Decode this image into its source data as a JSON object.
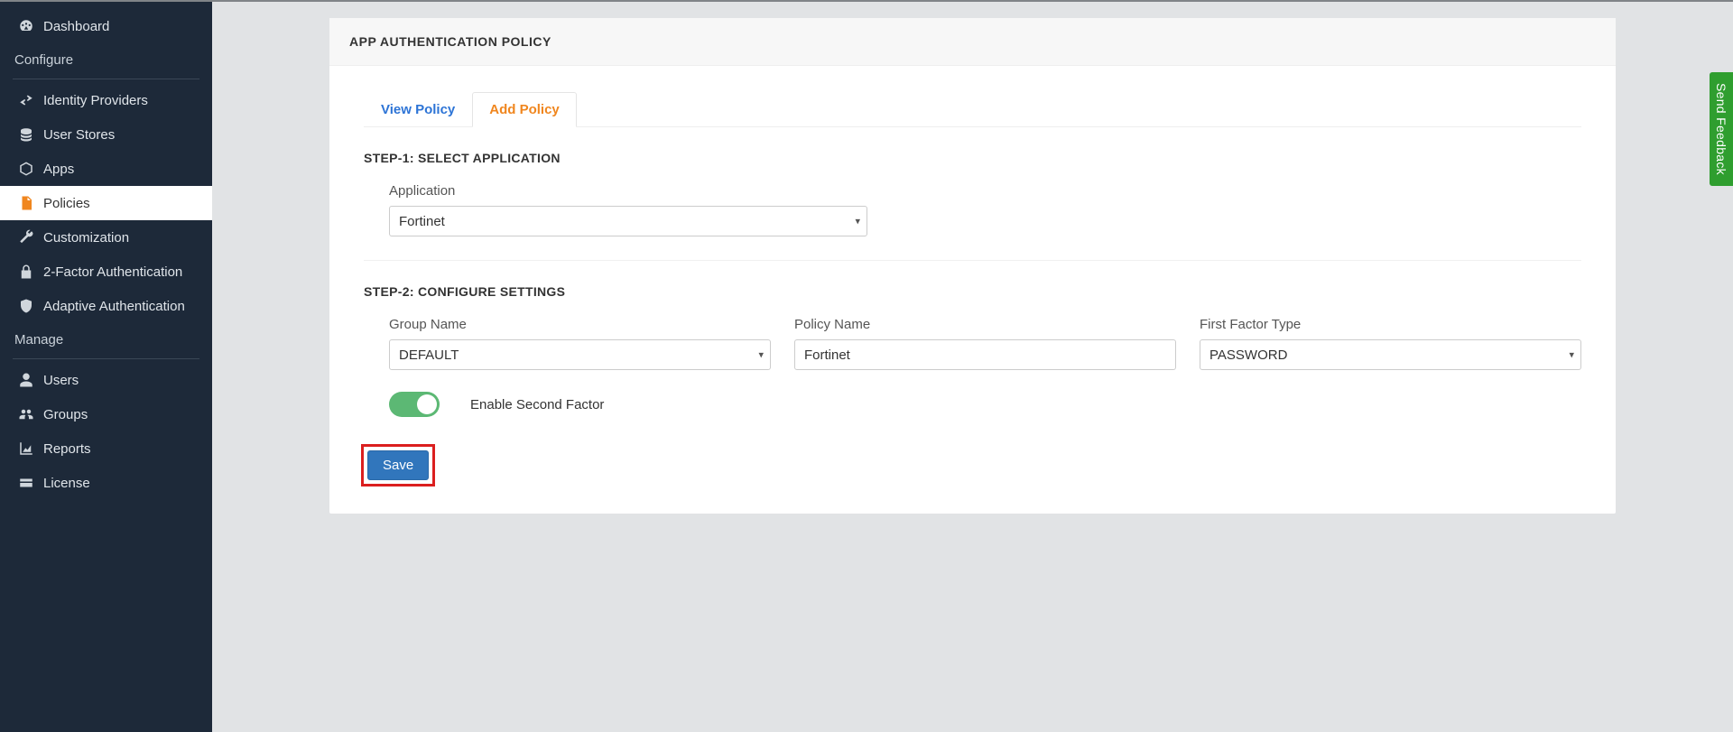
{
  "sidebar": {
    "dashboard": "Dashboard",
    "section_configure": "Configure",
    "identity_providers": "Identity Providers",
    "user_stores": "User Stores",
    "apps": "Apps",
    "policies": "Policies",
    "customization": "Customization",
    "two_factor": "2-Factor Authentication",
    "adaptive_auth": "Adaptive Authentication",
    "section_manage": "Manage",
    "users": "Users",
    "groups": "Groups",
    "reports": "Reports",
    "license": "License"
  },
  "card": {
    "title": "APP AUTHENTICATION POLICY"
  },
  "tabs": {
    "view": "View Policy",
    "add": "Add Policy"
  },
  "step1": {
    "title": "STEP-1: SELECT APPLICATION",
    "application_label": "Application",
    "application_value": "Fortinet"
  },
  "step2": {
    "title": "STEP-2: CONFIGURE SETTINGS",
    "group_name_label": "Group Name",
    "group_name_value": "DEFAULT",
    "policy_name_label": "Policy Name",
    "policy_name_value": "Fortinet",
    "first_factor_label": "First Factor Type",
    "first_factor_value": "PASSWORD",
    "enable_second_label": "Enable Second Factor"
  },
  "buttons": {
    "save": "Save"
  },
  "feedback": "Send Feedback"
}
